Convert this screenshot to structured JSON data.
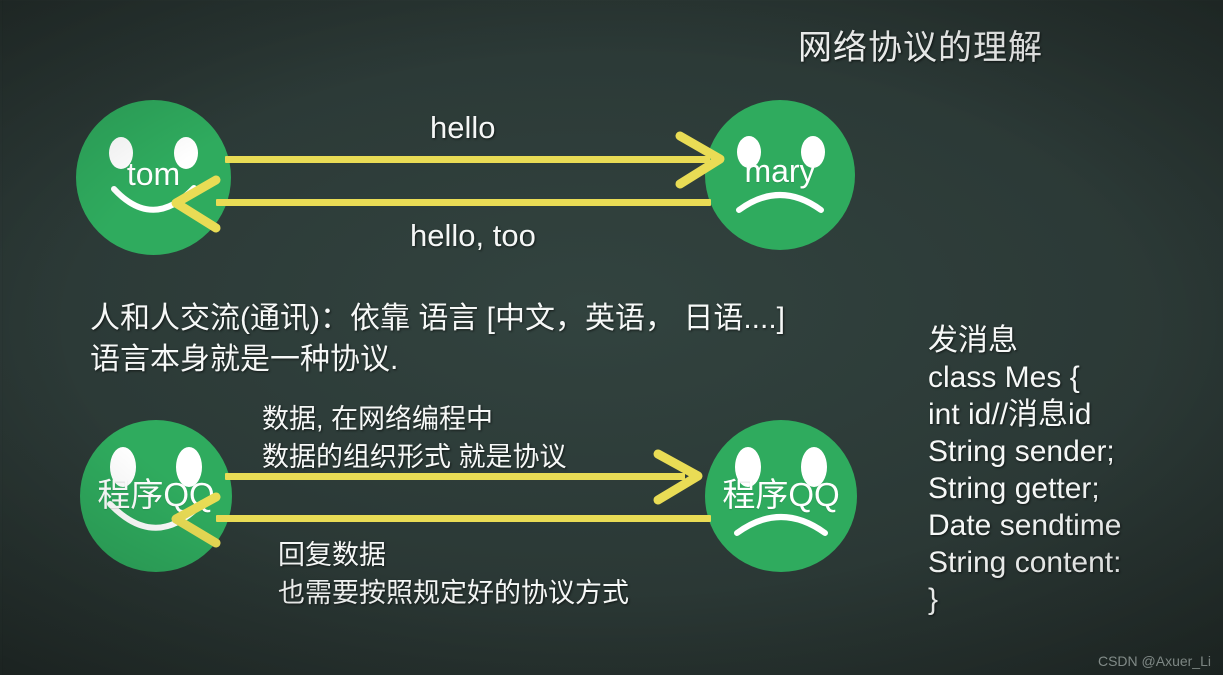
{
  "page": {
    "title": "网络协议的理解",
    "watermark": "CSDN @Axuer_Li",
    "colors": {
      "background": "#2c3a37",
      "face_green": "#2fab5e",
      "arrow_yellow": "#e9dc55",
      "text_white": "#f6f8f7"
    }
  },
  "top_diagram": {
    "left_node": {
      "label": "tom",
      "mood": "smile"
    },
    "right_node": {
      "label": "mary",
      "mood": "frown"
    },
    "forward_message": "hello",
    "reply_message": "hello, too"
  },
  "middle_text": {
    "line1": "人和人交流(通讯)：依靠 语言 [中文，英语， 日语....]",
    "line2": "语言本身就是一种协议."
  },
  "bottom_diagram": {
    "left_node": {
      "label": "程序QQ",
      "mood": "smile"
    },
    "right_node": {
      "label": "程序QQ",
      "mood": "frown"
    },
    "forward_note": {
      "line1": "数据, 在网络编程中",
      "line2": "数据的组织形式 就是协议"
    },
    "reply_note": {
      "line1": "回复数据",
      "line2": "也需要按照规定好的协议方式"
    }
  },
  "code_panel": {
    "heading": "发消息",
    "lines": [
      "class Mes {",
      "int id//消息id",
      "String sender;",
      "String getter;",
      "Date sendtime",
      "String content:",
      "}"
    ]
  }
}
